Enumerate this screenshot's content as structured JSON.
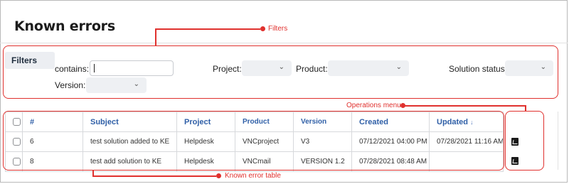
{
  "page": {
    "title": "Known errors"
  },
  "filters": {
    "tab_label": "Filters",
    "contains_label": "contains:",
    "contains_value": "",
    "project_label": "Project:",
    "project_value": "",
    "product_label": "Product:",
    "product_value": "",
    "solution_status_label": "Solution status:",
    "solution_status_value": "",
    "version_label": "Version:",
    "version_value": ""
  },
  "annotations": {
    "filters": "Filters",
    "operations_menu": "Operations menu",
    "known_error_table": "Known error table",
    "color": "#e0312e"
  },
  "table": {
    "columns": [
      "#",
      "Subject",
      "Project",
      "Product",
      "Version",
      "Created",
      "Updated"
    ],
    "sort_icon": "sort-descending-icon",
    "rows": [
      {
        "id": "6",
        "subject": "test solution added to KE",
        "project": "Helpdesk",
        "product": "VNCproject",
        "version": "V3",
        "created": "07/12/2021 04:00 PM",
        "updated": "07/28/2021 11:16 AM"
      },
      {
        "id": "8",
        "subject": "test add solution to KE",
        "project": "Helpdesk",
        "product": "VNCmail",
        "version": "VERSION 1.2",
        "created": "07/28/2021 08:48 AM",
        "updated": ""
      }
    ]
  },
  "operations": {
    "icon": "pdf-icon"
  },
  "colors": {
    "header_text": "#2f5fa7",
    "callout": "#e0312e"
  }
}
